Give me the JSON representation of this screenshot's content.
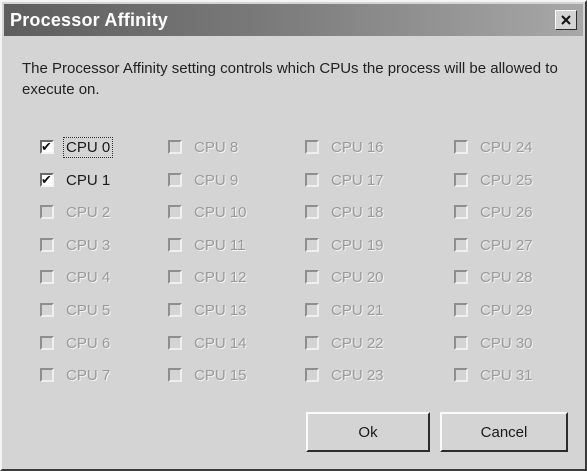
{
  "window": {
    "title": "Processor Affinity",
    "close_icon": "close-icon"
  },
  "description": "The Processor Affinity setting controls which CPUs the process will be allowed to execute on.",
  "cpus": [
    {
      "label": "CPU 0",
      "checked": true,
      "enabled": true
    },
    {
      "label": "CPU 1",
      "checked": true,
      "enabled": true
    },
    {
      "label": "CPU 2",
      "checked": false,
      "enabled": false
    },
    {
      "label": "CPU 3",
      "checked": false,
      "enabled": false
    },
    {
      "label": "CPU 4",
      "checked": false,
      "enabled": false
    },
    {
      "label": "CPU 5",
      "checked": false,
      "enabled": false
    },
    {
      "label": "CPU 6",
      "checked": false,
      "enabled": false
    },
    {
      "label": "CPU 7",
      "checked": false,
      "enabled": false
    },
    {
      "label": "CPU 8",
      "checked": false,
      "enabled": false
    },
    {
      "label": "CPU 9",
      "checked": false,
      "enabled": false
    },
    {
      "label": "CPU 10",
      "checked": false,
      "enabled": false
    },
    {
      "label": "CPU 11",
      "checked": false,
      "enabled": false
    },
    {
      "label": "CPU 12",
      "checked": false,
      "enabled": false
    },
    {
      "label": "CPU 13",
      "checked": false,
      "enabled": false
    },
    {
      "label": "CPU 14",
      "checked": false,
      "enabled": false
    },
    {
      "label": "CPU 15",
      "checked": false,
      "enabled": false
    },
    {
      "label": "CPU 16",
      "checked": false,
      "enabled": false
    },
    {
      "label": "CPU 17",
      "checked": false,
      "enabled": false
    },
    {
      "label": "CPU 18",
      "checked": false,
      "enabled": false
    },
    {
      "label": "CPU 19",
      "checked": false,
      "enabled": false
    },
    {
      "label": "CPU 20",
      "checked": false,
      "enabled": false
    },
    {
      "label": "CPU 21",
      "checked": false,
      "enabled": false
    },
    {
      "label": "CPU 22",
      "checked": false,
      "enabled": false
    },
    {
      "label": "CPU 23",
      "checked": false,
      "enabled": false
    },
    {
      "label": "CPU 24",
      "checked": false,
      "enabled": false
    },
    {
      "label": "CPU 25",
      "checked": false,
      "enabled": false
    },
    {
      "label": "CPU 26",
      "checked": false,
      "enabled": false
    },
    {
      "label": "CPU 27",
      "checked": false,
      "enabled": false
    },
    {
      "label": "CPU 28",
      "checked": false,
      "enabled": false
    },
    {
      "label": "CPU 29",
      "checked": false,
      "enabled": false
    },
    {
      "label": "CPU 30",
      "checked": false,
      "enabled": false
    },
    {
      "label": "CPU 31",
      "checked": false,
      "enabled": false
    }
  ],
  "buttons": {
    "ok_label": "Ok",
    "cancel_label": "Cancel"
  },
  "colors": {
    "title_bar_start": "#5e5e5e",
    "title_bar_end": "#a8a8a8",
    "dialog_face": "#d4d4d4",
    "disabled_text": "#9a9a9a"
  }
}
